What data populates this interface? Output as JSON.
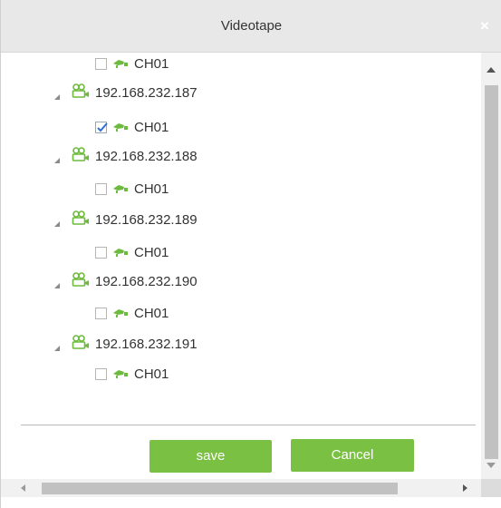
{
  "dialog": {
    "title": "Videotape",
    "close_label": "×"
  },
  "tree": {
    "partial_channel": {
      "label": "CH01",
      "checked": false
    },
    "devices": [
      {
        "ip": "192.168.232.187",
        "channel": {
          "label": "CH01",
          "checked": true
        }
      },
      {
        "ip": "192.168.232.188",
        "channel": {
          "label": "CH01",
          "checked": false
        }
      },
      {
        "ip": "192.168.232.189",
        "channel": {
          "label": "CH01",
          "checked": false
        }
      },
      {
        "ip": "192.168.232.190",
        "channel": {
          "label": "CH01",
          "checked": false
        }
      },
      {
        "ip": "192.168.232.191",
        "channel": {
          "label": "CH01",
          "checked": false
        }
      }
    ]
  },
  "buttons": {
    "save_label": "save",
    "cancel_label": "Cancel"
  },
  "colors": {
    "accent_green": "#7ac143",
    "icon_green": "#6cbb3c",
    "titlebar_bg": "#e8e8e8",
    "check_blue": "#2f6fd6"
  },
  "icons": {
    "device": "device-camera-icon",
    "channel": "channel-camera-icon",
    "expand": "expand-triangle-icon",
    "close": "close-icon"
  }
}
